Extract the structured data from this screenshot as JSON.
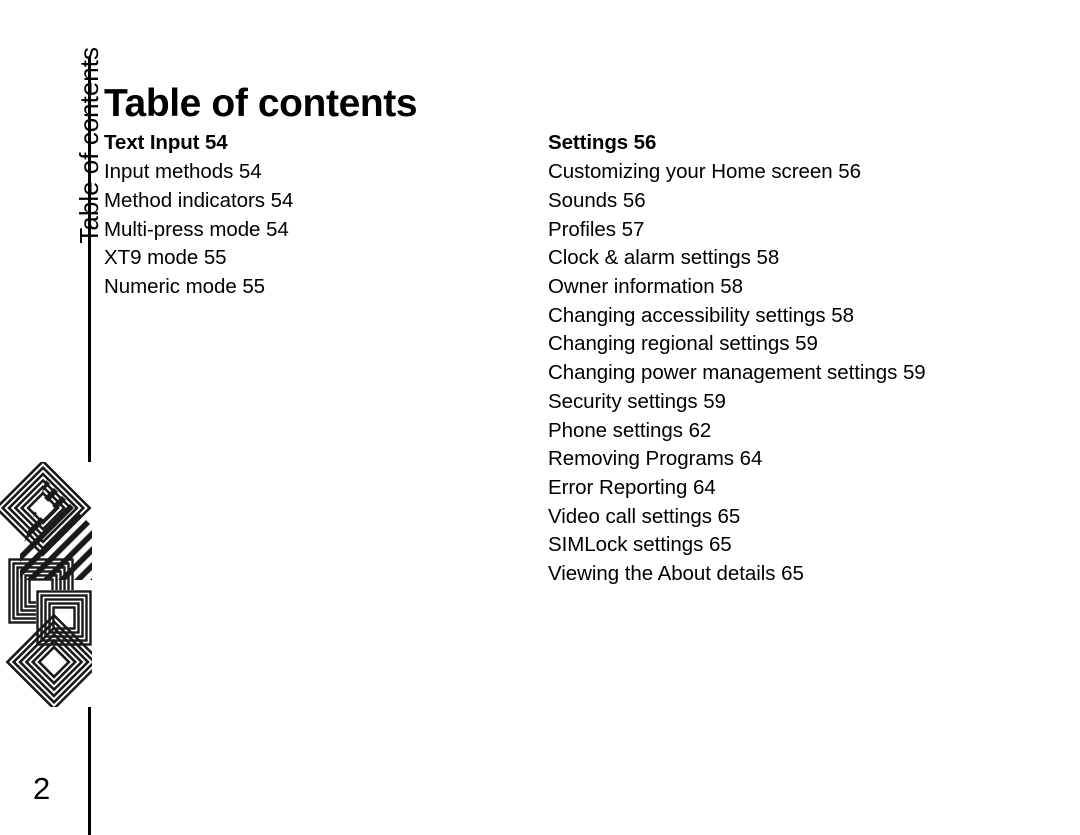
{
  "page": {
    "title": "Table of contents",
    "side_tab_label": "Table of contents",
    "page_number": "2"
  },
  "columns": {
    "left": {
      "heading": "Text Input 54",
      "entries": [
        "Input methods 54",
        "Method indicators 54",
        "Multi-press mode 54",
        "XT9 mode 55",
        "Numeric mode 55"
      ]
    },
    "right": {
      "heading": "Settings 56",
      "entries": [
        "Customizing your Home screen 56",
        "Sounds 56",
        "Profiles 57",
        "Clock & alarm settings 58",
        "Owner information 58",
        "Changing accessibility settings 58",
        "Changing regional settings 59",
        "Changing power management settings 59",
        "Security settings 59",
        "Phone settings 62",
        "Removing Programs 64",
        "Error Reporting 64",
        "Video call settings 65",
        "SIMLock settings 65",
        "Viewing the About details 65"
      ]
    }
  },
  "decoration": {
    "name": "diamond-square-motif",
    "colors": {
      "ink": "#1a1a1a",
      "paper": "#ffffff"
    }
  }
}
